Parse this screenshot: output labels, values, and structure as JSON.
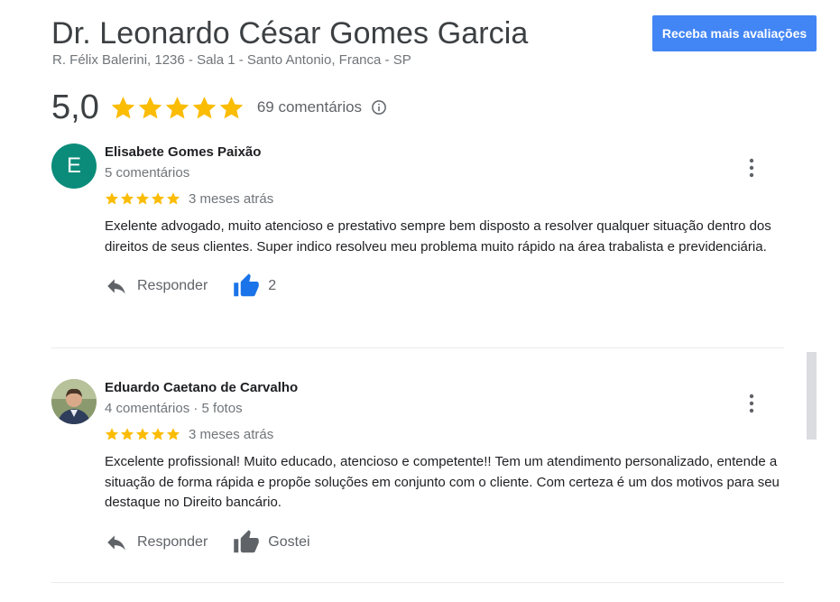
{
  "header": {
    "title": "Dr. Leonardo César Gomes Garcia",
    "address": "R. Félix Balerini, 1236 - Sala 1 - Santo Antonio, Franca - SP",
    "cta_label": "Receba mais avaliações",
    "score": "5,0",
    "stars": 5,
    "review_count": "69 comentários",
    "info_icon": "info-icon"
  },
  "colors": {
    "star": "#fbbc04",
    "like_active": "#1a73e8",
    "cta": "#4285f4",
    "avatar_e": "#0b8c7a"
  },
  "reviews": [
    {
      "avatar_letter": "E",
      "name": "Elisabete Gomes Paixão",
      "meta": "5 comentários",
      "stars": 5,
      "date": "3 meses atrás",
      "text": "Exelente advogado, muito atencioso e prestativo sempre bem disposto a resolver qualquer situação dentro dos direitos de seus clientes. Super indico resolveu meu problema muito rápido na área trabalista e previdenciária.",
      "reply_label": "Responder",
      "like_label": "2",
      "liked": true
    },
    {
      "avatar_letter": "",
      "name": "Eduardo Caetano de Carvalho",
      "meta": "4 comentários · 5 fotos",
      "stars": 5,
      "date": "3 meses atrás",
      "text": "Excelente profissional! Muito educado, atencioso e competente!! Tem um atendimento personalizado, entende a situação de forma rápida e propõe soluções em conjunto com o cliente. Com certeza é um dos motivos para seu destaque no Direito bancário.",
      "reply_label": "Responder",
      "like_label": "Gostei",
      "liked": false
    }
  ]
}
